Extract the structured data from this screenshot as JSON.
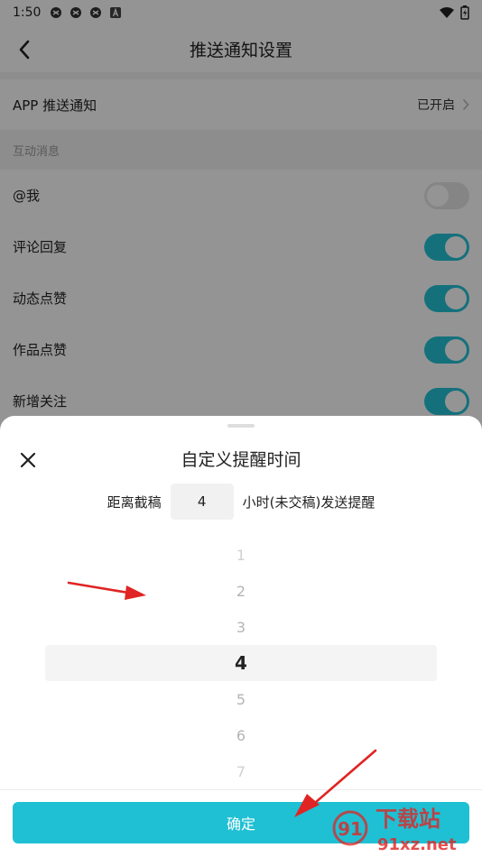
{
  "status_bar": {
    "time": "1:50"
  },
  "nav": {
    "title": "推送通知设置"
  },
  "app_push": {
    "label": "APP 推送通知",
    "value": "已开启"
  },
  "section_label": "互动消息",
  "toggles": [
    {
      "label": "@我",
      "on": false
    },
    {
      "label": "评论回复",
      "on": true
    },
    {
      "label": "动态点赞",
      "on": true
    },
    {
      "label": "作品点赞",
      "on": true
    },
    {
      "label": "新增关注",
      "on": true
    }
  ],
  "sheet": {
    "title": "自定义提醒时间",
    "prefix": "距离截稿",
    "hours_value": "4",
    "suffix": "小时(未交稿)发送提醒",
    "picker_options": [
      "1",
      "2",
      "3",
      "4",
      "5",
      "6",
      "7"
    ],
    "selected_option": "4",
    "confirm_label": "确定"
  },
  "watermark": {
    "text_top": "下载站",
    "text_bottom": "91xz.net",
    "logo": "91"
  },
  "colors": {
    "accent": "#1fc0d3",
    "toggle_on": "#23c3d6",
    "annotation_arrow": "#e02424"
  }
}
